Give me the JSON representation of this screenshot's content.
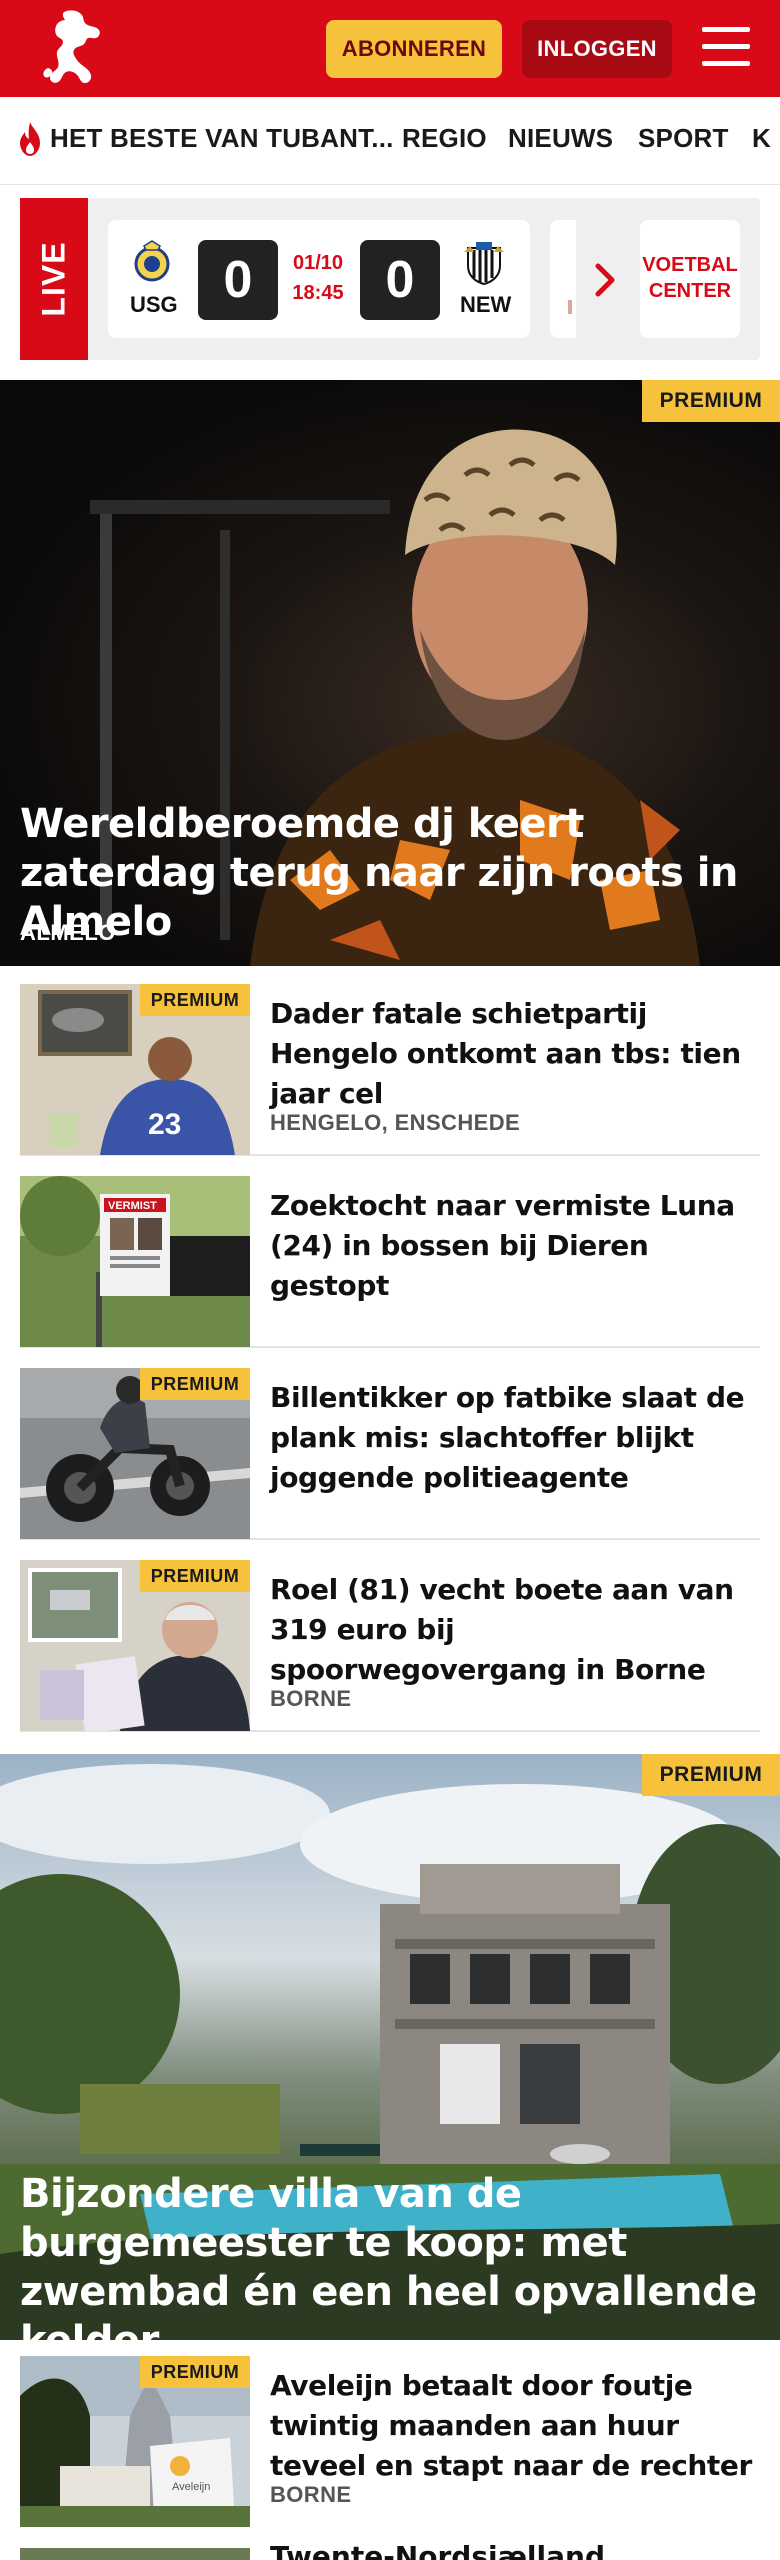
{
  "header": {
    "subscribe_label": "ABONNEREN",
    "login_label": "INLOGGEN",
    "brand_color": "#d80a17",
    "accent_color": "#f6c23c"
  },
  "nav": {
    "items": [
      {
        "label": "HET BESTE VAN TUBANT..."
      },
      {
        "label": "REGIO"
      },
      {
        "label": "NIEUWS"
      },
      {
        "label": "SPORT"
      },
      {
        "label": "K"
      }
    ]
  },
  "live": {
    "label": "LIVE",
    "match": {
      "home_team": "USG",
      "away_team": "NEW",
      "home_score": "0",
      "away_score": "0",
      "date": "01/10",
      "time": "18:45"
    },
    "voetbal_center_line1": "VOETBAL",
    "voetbal_center_line2": "CENTER"
  },
  "hero": {
    "premium_label": "PREMIUM",
    "title": "Wereldberoemde dj keert zaterdag terug naar zijn roots in Almelo",
    "location": "ALMELO"
  },
  "articles": [
    {
      "premium": "PREMIUM",
      "title": "Dader fatale schietpartij Hengelo ontkomt aan tbs: tien jaar cel",
      "location": "HENGELO, ENSCHEDE"
    },
    {
      "premium": "",
      "title": "Zoektocht naar vermiste Luna (24) in bossen bij Dieren gestopt",
      "location": ""
    },
    {
      "premium": "PREMIUM",
      "title": "Billentikker op fatbike slaat de plank mis: slachtoffer blijkt joggende politieagente",
      "location": ""
    },
    {
      "premium": "PREMIUM",
      "title": "Roel (81) vecht boete aan van 319 euro bij spoorwegovergang in Borne",
      "location": "BORNE"
    }
  ],
  "hero2": {
    "premium_label": "PREMIUM",
    "title": "Bijzondere villa van de burgemeester te koop: met zwembad én een heel opvallende kelder"
  },
  "article5": {
    "premium": "PREMIUM",
    "title": "Aveleijn betaalt door foutje twintig maanden aan huur teveel en stapt naar de rechter",
    "location": "BORNE",
    "sign_text": "Aveleijn"
  },
  "next_teaser": {
    "title": "Twente-Nordsjælland"
  },
  "thumb_texts": {
    "luna_poster": "VERMIST",
    "jersey_number": "23"
  }
}
